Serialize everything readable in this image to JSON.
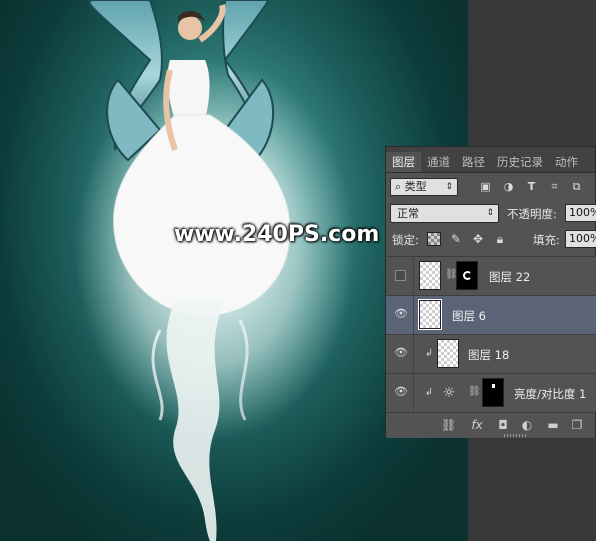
{
  "watermark": "www.240PS.com",
  "colors": {
    "bg_teal": "#1d5f5c",
    "panel": "#535353",
    "selected_layer": "#5a6476"
  },
  "panel": {
    "tabs": [
      "图层",
      "通道",
      "路径",
      "历史记录",
      "动作"
    ],
    "filter": {
      "value": "类型"
    },
    "filter_icons": [
      "image-filter-icon",
      "adjustment-filter-icon",
      "type-filter-icon",
      "shape-filter-icon",
      "smart-object-filter-icon"
    ],
    "blend_mode": "正常",
    "opacity_label": "不透明度:",
    "opacity_value": "100%",
    "lock_label": "锁定:",
    "fill_label": "填充:",
    "fill_value": "100%",
    "layers": [
      {
        "name": "图层 22",
        "visible": false,
        "has_mask": true
      },
      {
        "name": "图层 6",
        "visible": true,
        "selected": true
      },
      {
        "name": "图层 18",
        "visible": true,
        "clipped": true
      },
      {
        "name": "亮度/对比度 1",
        "visible": true,
        "clipped": true,
        "adjustment": true,
        "has_mask": true
      }
    ],
    "bottom_icons": [
      "link-layers-icon",
      "fx-icon",
      "add-mask-icon",
      "adjustment-layer-icon",
      "group-folder-icon",
      "new-layer-icon",
      "trash-icon"
    ],
    "fx_label": "fx"
  }
}
